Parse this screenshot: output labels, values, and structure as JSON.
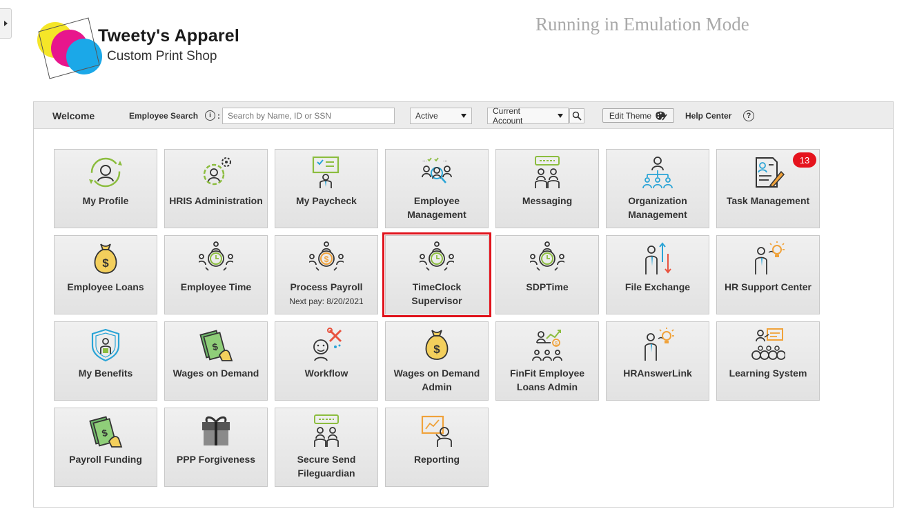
{
  "brand": {
    "name": "Tweety's Apparel",
    "tagline": "Custom Print Shop",
    "colors": {
      "yellow": "#f5e628",
      "magenta": "#e8168c",
      "cyan": "#1ba8e8"
    }
  },
  "banner": "Running in Emulation Mode",
  "toolbar": {
    "welcome": "Welcome",
    "search_label": "Employee Search",
    "info_glyph": "i",
    "colon": ":",
    "search_placeholder": "Search by Name, ID or SSN",
    "status_value": "Active",
    "account_value": "Current Account",
    "edit_theme": "Edit Theme",
    "help_center": "Help Center",
    "help_glyph": "?"
  },
  "tiles": [
    {
      "id": "my-profile",
      "label": "My Profile",
      "icon": "profile-refresh-icon"
    },
    {
      "id": "hris-administration",
      "label": "HRIS Administration",
      "icon": "person-gear-icon"
    },
    {
      "id": "my-paycheck",
      "label": "My Paycheck",
      "icon": "paycheck-sign-icon"
    },
    {
      "id": "employee-management",
      "label": "Employee Management",
      "icon": "team-magnifier-icon"
    },
    {
      "id": "messaging",
      "label": "Messaging",
      "icon": "chat-people-icon"
    },
    {
      "id": "organization-management",
      "label": "Organization Management",
      "icon": "org-chart-icon"
    },
    {
      "id": "task-management",
      "label": "Task Management",
      "icon": "document-pencil-icon",
      "badge": "13"
    },
    {
      "id": "employee-loans",
      "label": "Employee Loans",
      "icon": "money-bag-icon"
    },
    {
      "id": "employee-time",
      "label": "Employee Time",
      "icon": "clock-people-icon"
    },
    {
      "id": "process-payroll",
      "label": "Process Payroll",
      "icon": "coin-people-icon",
      "sub": "Next pay: 8/20/2021"
    },
    {
      "id": "timeclock-supervisor",
      "label": "TimeClock Supervisor",
      "icon": "clock-people-icon",
      "highlight": true
    },
    {
      "id": "sdptime",
      "label": "SDPTime",
      "icon": "clock-people-icon"
    },
    {
      "id": "file-exchange",
      "label": "File Exchange",
      "icon": "person-arrows-icon"
    },
    {
      "id": "hr-support-center",
      "label": "HR Support Center",
      "icon": "person-lightbulb-icon"
    },
    {
      "id": "my-benefits",
      "label": "My Benefits",
      "icon": "shield-person-icon"
    },
    {
      "id": "wages-on-demand",
      "label": "Wages on Demand",
      "icon": "cash-hand-icon"
    },
    {
      "id": "workflow",
      "label": "Workflow",
      "icon": "person-tools-icon"
    },
    {
      "id": "wages-on-demand-admin",
      "label": "Wages on Demand Admin",
      "icon": "money-bag-icon"
    },
    {
      "id": "finfit-employee-loans-admin",
      "label": "FinFit Employee Loans Admin",
      "icon": "presenter-chart-icon"
    },
    {
      "id": "hranswerlink",
      "label": "HRAnswerLink",
      "icon": "person-lightbulb-icon"
    },
    {
      "id": "learning-system",
      "label": "Learning System",
      "icon": "teacher-class-icon"
    },
    {
      "id": "payroll-funding",
      "label": "Payroll Funding",
      "icon": "cash-hand-icon"
    },
    {
      "id": "ppp-forgiveness",
      "label": "PPP Forgiveness",
      "icon": "gift-icon"
    },
    {
      "id": "secure-send-fileguardian",
      "label": "Secure Send Fileguardian",
      "icon": "chat-people-icon"
    },
    {
      "id": "reporting",
      "label": "Reporting",
      "icon": "report-board-icon"
    }
  ]
}
